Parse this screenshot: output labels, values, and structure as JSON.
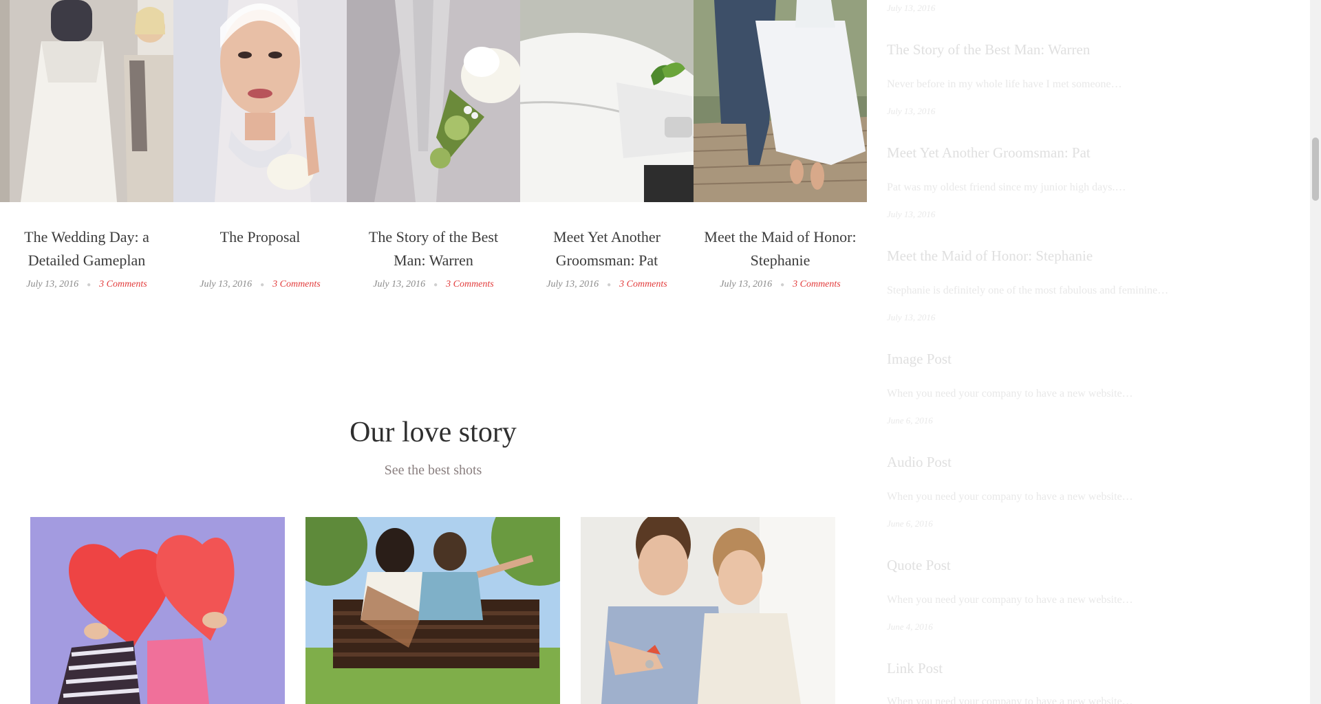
{
  "posts": [
    {
      "title": "The Wedding Day: a Detailed Gameplan",
      "date": "July 13, 2016",
      "comments": "3 Comments"
    },
    {
      "title": "The Proposal",
      "date": "July 13, 2016",
      "comments": "3 Comments"
    },
    {
      "title": "The Story of the Best Man: Warren",
      "date": "July 13, 2016",
      "comments": "3 Comments"
    },
    {
      "title": "Meet Yet Another Groomsman: Pat",
      "date": "July 13, 2016",
      "comments": "3 Comments"
    },
    {
      "title": "Meet the Maid of Honor: Stephanie",
      "date": "July 13, 2016",
      "comments": "3 Comments"
    }
  ],
  "slide_images": [
    {
      "icon": "bride-dress-fitting-image"
    },
    {
      "icon": "bride-veil-portrait-image"
    },
    {
      "icon": "groom-tie-boutonniere-image"
    },
    {
      "icon": "white-limousine-image"
    },
    {
      "icon": "couple-walking-boardwalk-image"
    }
  ],
  "story": {
    "title": "Our love story",
    "subtitle": "See the best shots"
  },
  "gallery": [
    {
      "icon": "couple-red-hearts-image"
    },
    {
      "icon": "couple-on-bench-image"
    },
    {
      "icon": "couple-house-keys-image"
    }
  ],
  "sidebar": {
    "top_date": "July 13, 2016",
    "items": [
      {
        "title": "The Story of the Best Man: Warren",
        "excerpt": "Never before in my whole life have I met someone…",
        "date": "July 13, 2016"
      },
      {
        "title": "Meet Yet Another Groomsman: Pat",
        "excerpt": "Pat was my oldest friend since my junior high days.…",
        "date": "July 13, 2016"
      },
      {
        "title": "Meet the Maid of Honor: Stephanie",
        "excerpt": "Stephanie is definitely one of the most fabulous and feminine…",
        "date": "July 13, 2016"
      },
      {
        "title": "Image Post",
        "excerpt": "When you need your company to have a new website…",
        "date": "June 6, 2016"
      },
      {
        "title": "Audio Post",
        "excerpt": "When you need your company to have a new website…",
        "date": "June 6, 2016"
      },
      {
        "title": "Quote Post",
        "excerpt": "When you need your company to have a new website…",
        "date": "June 4, 2016"
      },
      {
        "title": "Link Post",
        "excerpt": "When you need your company to have a new website…",
        "date": ""
      }
    ]
  },
  "colors": {
    "accent": "#e23b3b",
    "text": "#3b3b3b",
    "muted": "#8a8a8a"
  }
}
